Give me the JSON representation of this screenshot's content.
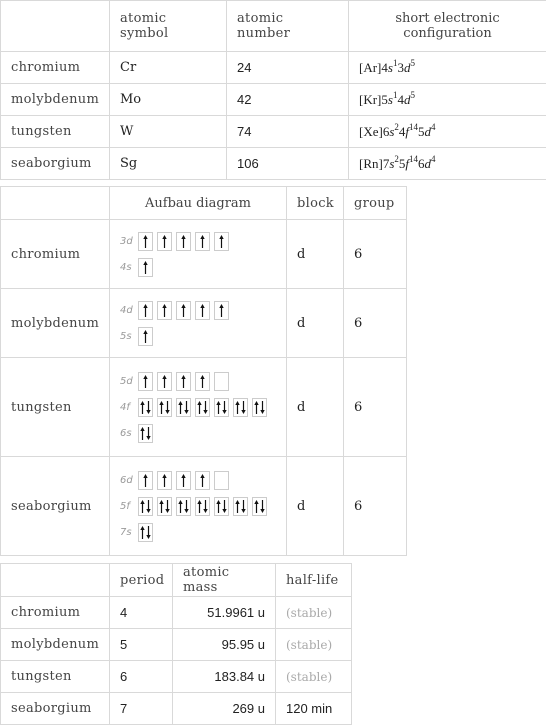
{
  "table1": {
    "headers": [
      "",
      "atomic symbol",
      "atomic number",
      "short electronic configuration"
    ],
    "rows": [
      {
        "name": "chromium",
        "symbol": "Cr",
        "number": "24",
        "config": [
          [
            "[Ar]4",
            ""
          ],
          [
            "s",
            "i"
          ],
          [
            "1",
            "sup"
          ],
          [
            "3",
            ""
          ],
          [
            "d",
            "i"
          ],
          [
            "5",
            "sup"
          ]
        ]
      },
      {
        "name": "molybdenum",
        "symbol": "Mo",
        "number": "42",
        "config": [
          [
            "[Kr]5",
            ""
          ],
          [
            "s",
            "i"
          ],
          [
            "1",
            "sup"
          ],
          [
            "4",
            ""
          ],
          [
            "d",
            "i"
          ],
          [
            "5",
            "sup"
          ]
        ]
      },
      {
        "name": "tungsten",
        "symbol": "W",
        "number": "74",
        "config": [
          [
            "[Xe]6",
            ""
          ],
          [
            "s",
            "i"
          ],
          [
            "2",
            "sup"
          ],
          [
            "4",
            ""
          ],
          [
            "f",
            "i"
          ],
          [
            "14",
            "sup"
          ],
          [
            "5",
            ""
          ],
          [
            "d",
            "i"
          ],
          [
            "4",
            "sup"
          ]
        ]
      },
      {
        "name": "seaborgium",
        "symbol": "Sg",
        "number": "106",
        "config": [
          [
            "[Rn]7",
            ""
          ],
          [
            "s",
            "i"
          ],
          [
            "2",
            "sup"
          ],
          [
            "5",
            ""
          ],
          [
            "f",
            "i"
          ],
          [
            "14",
            "sup"
          ],
          [
            "6",
            ""
          ],
          [
            "d",
            "i"
          ],
          [
            "4",
            "sup"
          ]
        ]
      }
    ]
  },
  "table2": {
    "headers": [
      "",
      "Aufbau diagram",
      "block",
      "group"
    ],
    "rows": [
      {
        "name": "chromium",
        "block": "d",
        "group": "6",
        "orbitals": [
          {
            "label": "3d",
            "boxes": [
              1,
              1,
              1,
              1,
              1
            ]
          },
          {
            "label": "4s",
            "boxes": [
              1
            ]
          }
        ]
      },
      {
        "name": "molybdenum",
        "block": "d",
        "group": "6",
        "orbitals": [
          {
            "label": "4d",
            "boxes": [
              1,
              1,
              1,
              1,
              1
            ]
          },
          {
            "label": "5s",
            "boxes": [
              1
            ]
          }
        ]
      },
      {
        "name": "tungsten",
        "block": "d",
        "group": "6",
        "orbitals": [
          {
            "label": "5d",
            "boxes": [
              1,
              1,
              1,
              1,
              0
            ]
          },
          {
            "label": "4f",
            "boxes": [
              2,
              2,
              2,
              2,
              2,
              2,
              2
            ]
          },
          {
            "label": "6s",
            "boxes": [
              2
            ]
          }
        ]
      },
      {
        "name": "seaborgium",
        "block": "d",
        "group": "6",
        "orbitals": [
          {
            "label": "6d",
            "boxes": [
              1,
              1,
              1,
              1,
              0
            ]
          },
          {
            "label": "5f",
            "boxes": [
              2,
              2,
              2,
              2,
              2,
              2,
              2
            ]
          },
          {
            "label": "7s",
            "boxes": [
              2
            ]
          }
        ]
      }
    ]
  },
  "table3": {
    "headers": [
      "",
      "period",
      "atomic mass",
      "half-life"
    ],
    "rows": [
      {
        "name": "chromium",
        "period": "4",
        "mass": "51.9961 u",
        "halflife": "(stable)",
        "stable": true
      },
      {
        "name": "molybdenum",
        "period": "5",
        "mass": "95.95 u",
        "halflife": "(stable)",
        "stable": true
      },
      {
        "name": "tungsten",
        "period": "6",
        "mass": "183.84 u",
        "halflife": "(stable)",
        "stable": true
      },
      {
        "name": "seaborgium",
        "period": "7",
        "mass": "269 u",
        "halflife": "120 min",
        "stable": false
      }
    ]
  }
}
